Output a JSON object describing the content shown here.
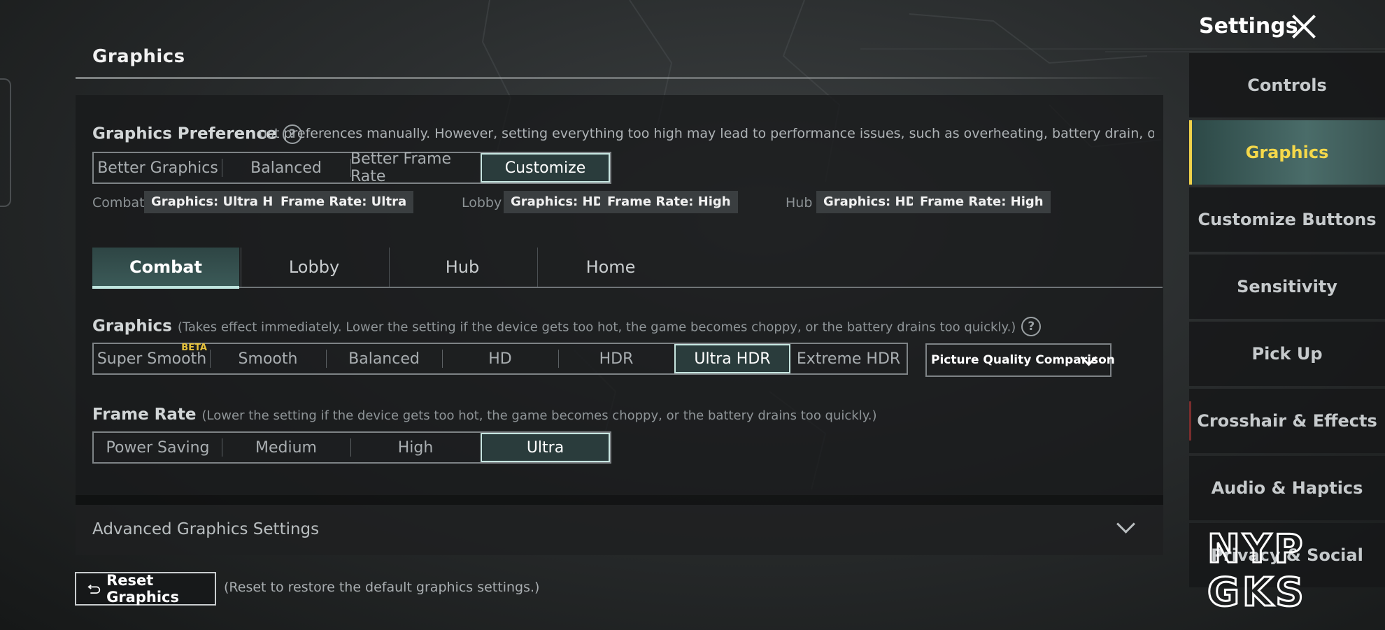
{
  "header": {
    "title": "Graphics"
  },
  "settings": {
    "title": "Settings"
  },
  "preference": {
    "label": "Graphics Preference",
    "help_glyph": "?",
    "marquee": "ust preferences manually. However, setting everything too high may lead to performance issues, such as overheating, battery drain, or choppy gamepl",
    "options": [
      "Better Graphics",
      "Balanced",
      "Better Frame Rate",
      "Customize"
    ],
    "selected": "Customize"
  },
  "summary": {
    "combat": {
      "label": "Combat",
      "graphics": "Graphics: Ultra HD",
      "frame_rate": "Frame Rate: Ultra"
    },
    "lobby": {
      "label": "Lobby",
      "graphics": "Graphics: HD",
      "frame_rate": "Frame Rate: High"
    },
    "hub": {
      "label": "Hub",
      "graphics": "Graphics: HD",
      "frame_rate": "Frame Rate: High"
    }
  },
  "tabs": {
    "items": [
      "Combat",
      "Lobby",
      "Hub",
      "Home"
    ],
    "active": "Combat"
  },
  "graphics_quality": {
    "label": "Graphics",
    "note": "(Takes effect immediately. Lower the setting if the device gets too hot, the game becomes choppy, or the battery drains too quickly.)",
    "help_glyph": "?",
    "options": [
      "Super Smooth",
      "Smooth",
      "Balanced",
      "HD",
      "HDR",
      "Ultra HDR",
      "Extreme HDR"
    ],
    "beta_badge": "BETA",
    "selected": "Ultra HDR",
    "comparison_dropdown": "Picture Quality Comparison"
  },
  "frame_rate": {
    "label": "Frame Rate",
    "note": "(Lower the setting if the device gets too hot, the game becomes choppy, or the battery drains too quickly.)",
    "options": [
      "Power Saving",
      "Medium",
      "High",
      "Ultra"
    ],
    "selected": "Ultra"
  },
  "advanced": {
    "label": "Advanced Graphics Settings"
  },
  "reset": {
    "label": "Reset Graphics",
    "note": "(Reset to restore the default graphics settings.)"
  },
  "sidebar": {
    "items": [
      "Controls",
      "Graphics",
      "Customize Buttons",
      "Sensitivity",
      "Pick Up",
      "Crosshair & Effects",
      "Audio & Haptics",
      "Privacy & Social"
    ],
    "active": "Graphics"
  },
  "watermark": {
    "line1": "NYP",
    "line2": "GKS"
  },
  "colors": {
    "accent": "#bfe4de",
    "active_tab_bg": "#3b5a58",
    "sidebar_active_text": "#f5d84a",
    "beta": "#e6c23b"
  },
  "icons": {
    "close": "close-icon",
    "help": "help-icon",
    "reset": "reset-arrow-icon",
    "dropdown": "chevron-down-icon"
  }
}
